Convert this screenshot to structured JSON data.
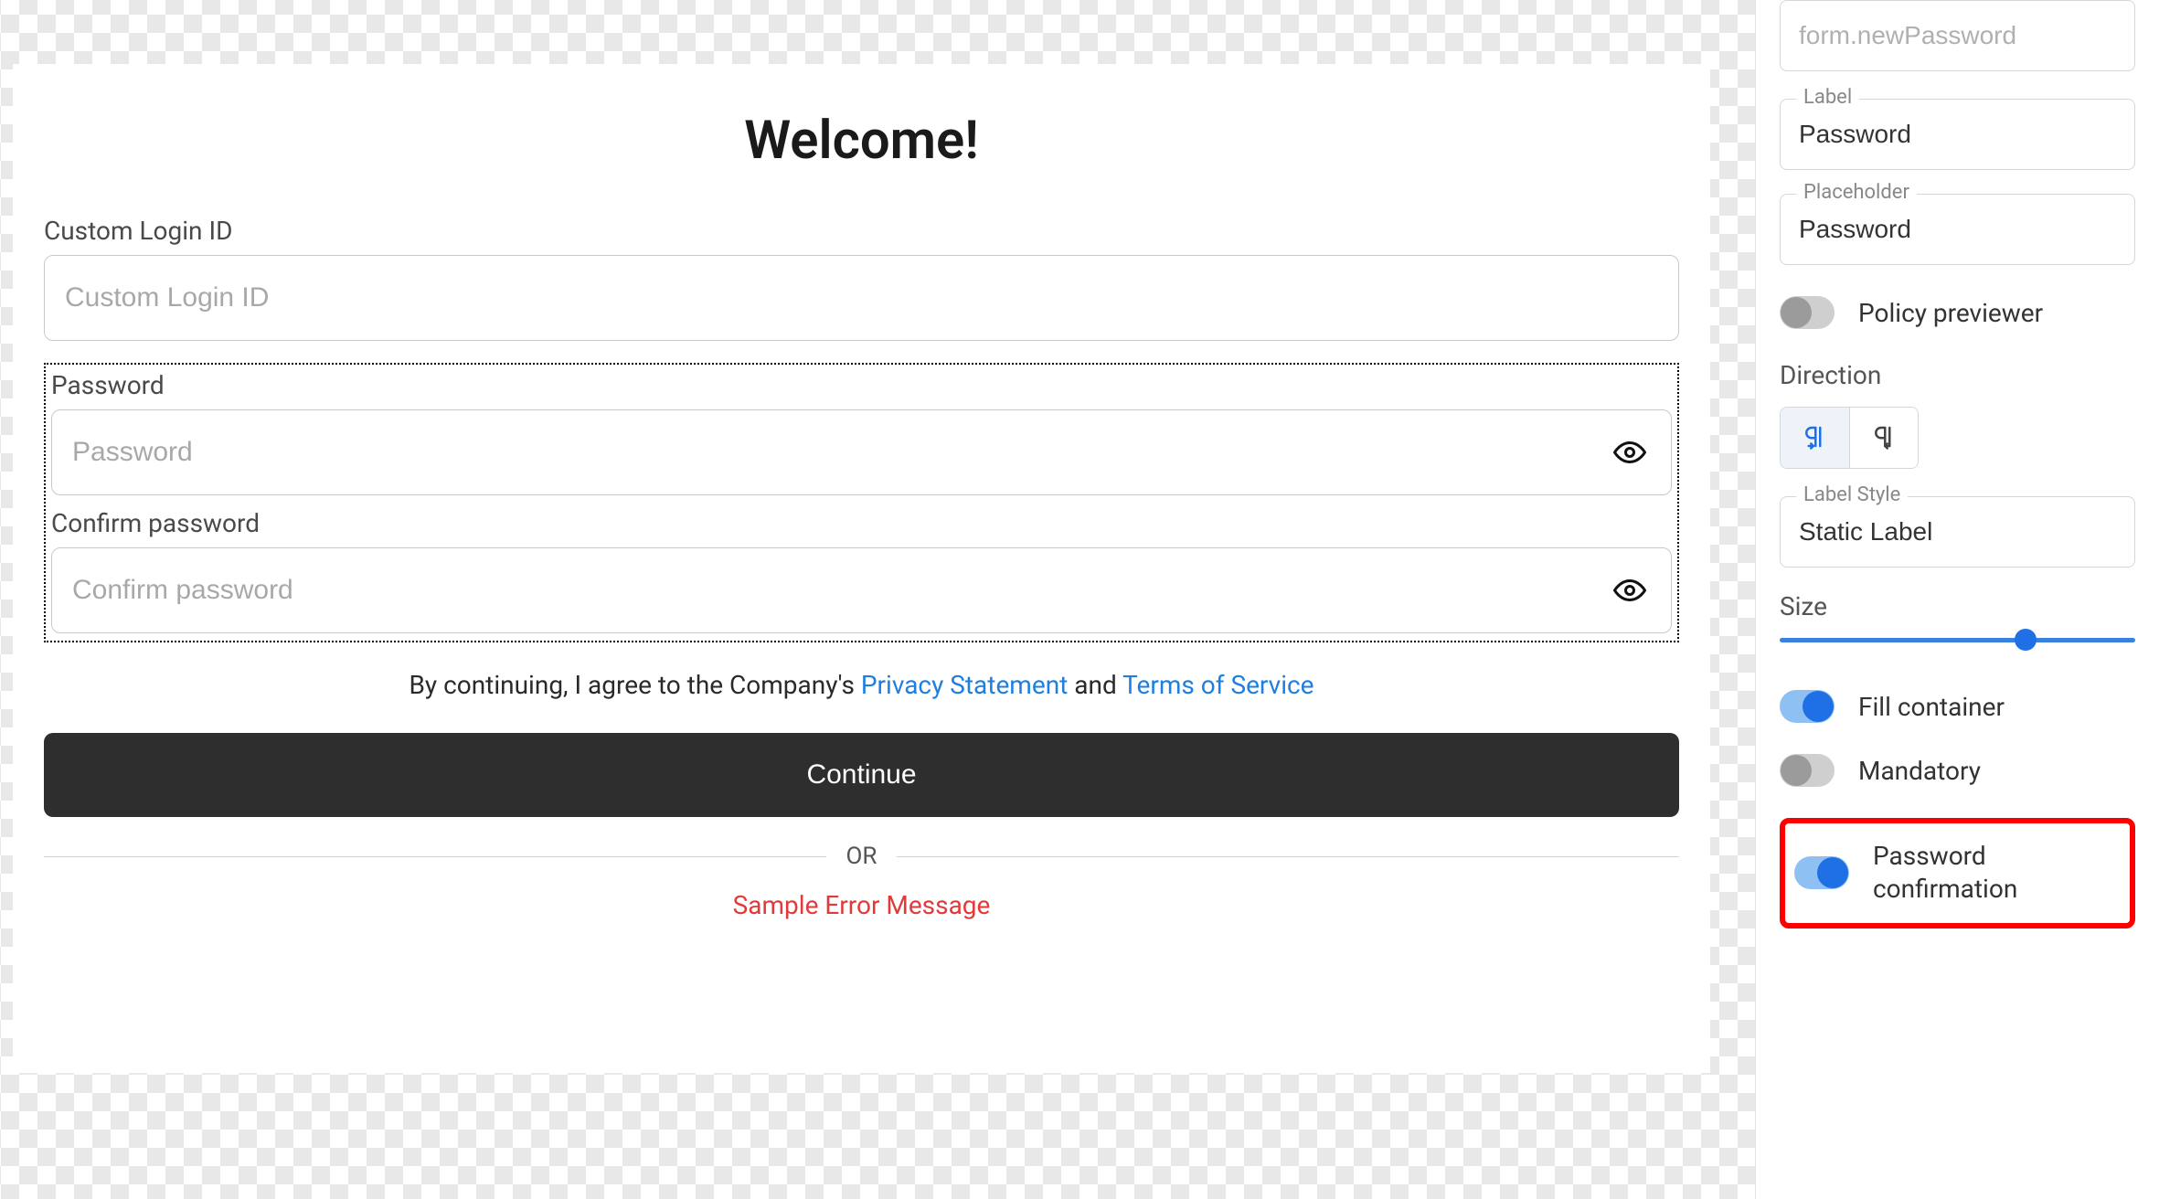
{
  "canvas": {
    "title": "Welcome!",
    "login_id": {
      "label": "Custom Login ID",
      "placeholder": "Custom Login ID"
    },
    "password": {
      "label": "Password",
      "placeholder": "Password"
    },
    "confirm": {
      "label": "Confirm password",
      "placeholder": "Confirm password"
    },
    "agree_prefix": "By continuing, I agree to the Company's ",
    "privacy_link": "Privacy Statement",
    "agree_mid": " and ",
    "terms_link": "Terms of Service",
    "continue_label": "Continue",
    "divider": "OR",
    "error": "Sample Error Message"
  },
  "sidebar": {
    "binding": {
      "placeholder": "form.newPassword"
    },
    "label_field": {
      "label": "Label",
      "value": "Password"
    },
    "placeholder_field": {
      "label": "Placeholder",
      "value": "Password"
    },
    "policy_previewer": {
      "label": "Policy previewer",
      "on": false
    },
    "direction_label": "Direction",
    "label_style": {
      "label": "Label Style",
      "value": "Static Label"
    },
    "size_label": "Size",
    "fill_container": {
      "label": "Fill container",
      "on": true
    },
    "mandatory": {
      "label": "Mandatory",
      "on": false
    },
    "password_confirmation": {
      "label": "Password confirmation",
      "on": true
    }
  }
}
